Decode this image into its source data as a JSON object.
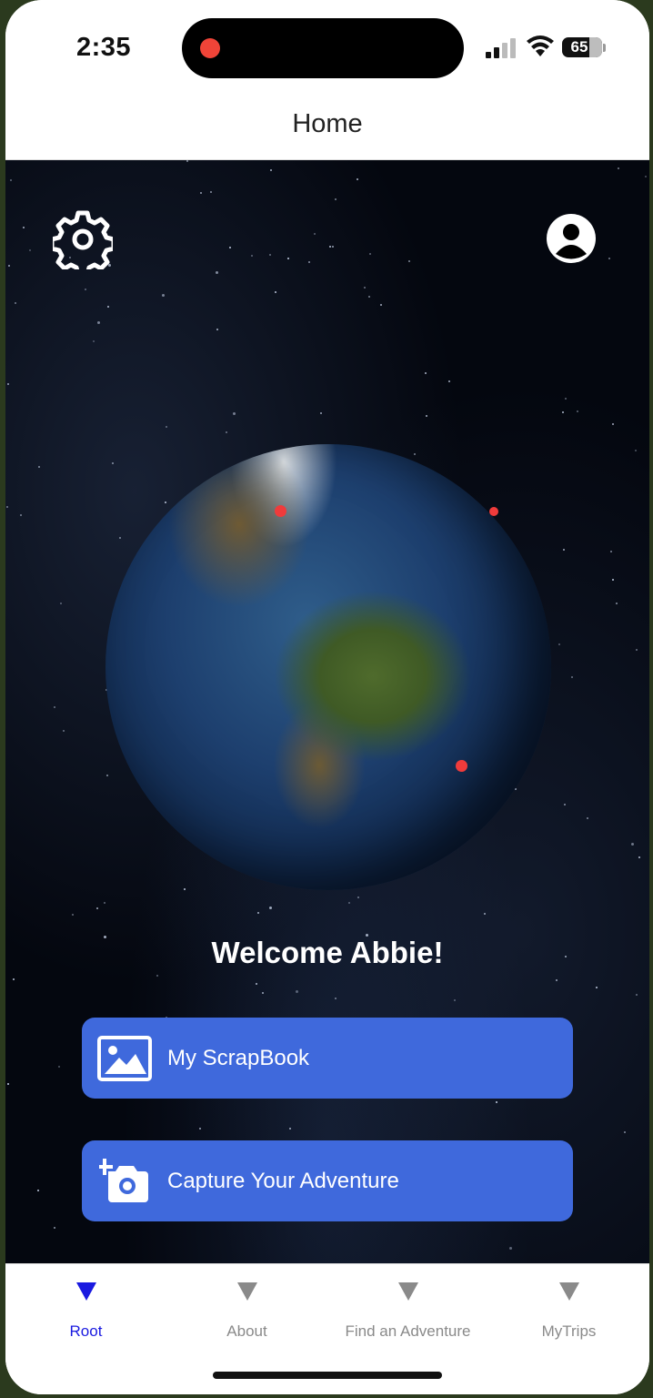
{
  "status_bar": {
    "time": "2:35",
    "battery": "65"
  },
  "nav": {
    "title": "Home"
  },
  "home": {
    "welcome": "Welcome Abbie!",
    "buttons": [
      {
        "label": "My ScrapBook",
        "icon": "image-icon"
      },
      {
        "label": "Capture Your Adventure",
        "icon": "add-camera-icon"
      }
    ]
  },
  "tabs": [
    {
      "label": "Root",
      "active": true
    },
    {
      "label": "About",
      "active": false
    },
    {
      "label": "Find an Adventure",
      "active": false
    },
    {
      "label": "MyTrips",
      "active": false
    }
  ],
  "colors": {
    "accent": "#3f69dc",
    "active_tab": "#1a1ae0",
    "marker": "#ef3b3b"
  }
}
